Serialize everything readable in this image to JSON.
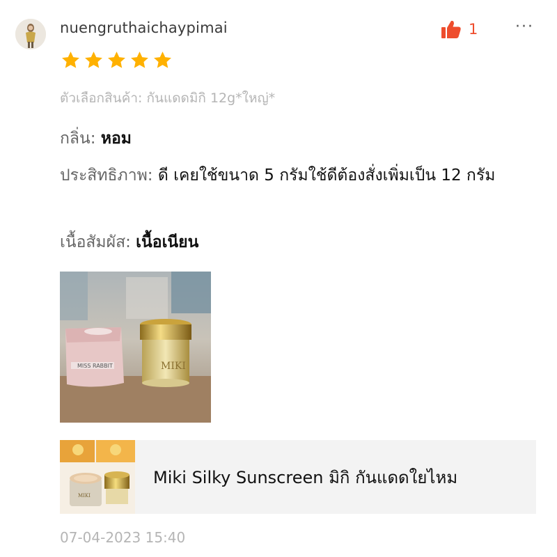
{
  "review": {
    "username": "nuengruthaichaypimai",
    "like_count": "1",
    "more_label": "···",
    "rating": 5,
    "rating_max": 5,
    "variation": "ตัวเลือกสินค้า: กันแดดมิกิ 12g*ใหญ่*",
    "attributes": [
      {
        "key": "กลิ่น: ",
        "value": "หอม"
      },
      {
        "key": "ประสิทธิภาพ: ",
        "value": "ดี เคยใช้ขนาด 5 กรัมใช้ดีต้องสั่งเพิ่มเป็น 12 กรัม"
      },
      {
        "key": "เนื้อสัมผัส: ",
        "value": "เนื้อเนียน"
      }
    ],
    "timestamp": "07-04-2023 15:40"
  },
  "product": {
    "name": "Miki Silky Sunscreen มิกิ กันแดดใยไหม"
  },
  "colors": {
    "accent": "#ee4d2d",
    "star": "#ffb100",
    "muted": "#b5b5b5"
  },
  "icons": {
    "like": "thumbs-up-icon",
    "more": "more-dots-icon",
    "star": "star-icon"
  }
}
